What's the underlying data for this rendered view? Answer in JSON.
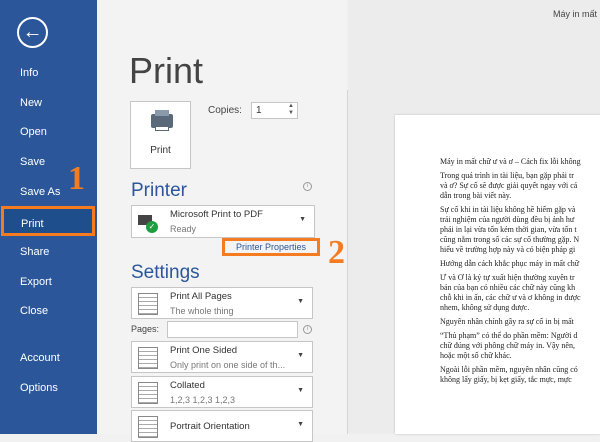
{
  "window_title": "Máy in mất",
  "sidebar": {
    "items": [
      "Info",
      "New",
      "Open",
      "Save",
      "Save As",
      "Print",
      "Share",
      "Export",
      "Close",
      "Account",
      "Options"
    ],
    "active": "Print"
  },
  "annotations": {
    "one": "1",
    "two": "2"
  },
  "print": {
    "title": "Print",
    "button": "Print",
    "copies_label": "Copies:",
    "copies_value": "1"
  },
  "printer": {
    "heading": "Printer",
    "name": "Microsoft Print to PDF",
    "status": "Ready",
    "properties": "Printer Properties"
  },
  "settings": {
    "heading": "Settings",
    "pages_label": "Pages:",
    "pages_value": "",
    "dropdowns": [
      {
        "t1": "Print All Pages",
        "t2": "The whole thing"
      },
      {
        "t1": "Print One Sided",
        "t2": "Only print on one side of th..."
      },
      {
        "t1": "Collated",
        "t2": "1,2,3    1,2,3    1,2,3"
      },
      {
        "t1": "Portrait Orientation",
        "t2": ""
      }
    ]
  },
  "preview": {
    "paragraphs": [
      "Máy in mất chữ ư và ơ – Cách fix lỗi không",
      "Trong quá trình in tài liệu, bạn gặp phải tr|và ơ? Sự cố sẽ được giải quyết ngay với cá|dẫn trong bài viết này.",
      "Sự cố khi in tài liệu không hề hiếm gặp và|trải nghiệm của người dùng đều bị ảnh hư|phải in lại vừa tốn kém thời gian, vừa tốn t|cũng nằm trong số các sự cố thường gặp. N|hiểu về trường hợp này và có biện pháp gi",
      "Hướng dẫn cách khắc phục máy in mất chữ",
      "Ư và Ơ là ký tự xuất hiện thường xuyên tr|bản của bạn có nhiều các chữ này cũng kh|chỗ khi in ấn, các chữ ư và ơ không in được|nhem, không sử dụng được.",
      "Nguyên nhân chính gây ra sự cố in bị mất",
      "“Thủ phạm” có thể do phần mềm: Người d|chữ đúng với phông chữ máy in. Vậy nên,|hoặc một số chữ khác.",
      "Ngoài lỗi phần mềm, nguyên nhân cũng có|không lấy giấy, bị kẹt giấy, tắc mực, mực"
    ]
  }
}
